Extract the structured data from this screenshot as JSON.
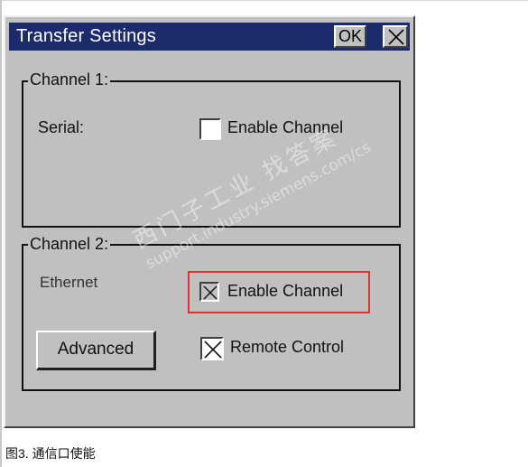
{
  "dialog": {
    "title": "Transfer Settings",
    "ok_label": "OK",
    "close_icon": "close-icon"
  },
  "channel1": {
    "group_label": "Channel 1:",
    "interface_label": "Serial:",
    "enable_label": "Enable Channel",
    "enable_checked": false
  },
  "channel2": {
    "group_label": "Channel 2:",
    "interface_label": "Ethernet",
    "enable_label": "Enable Channel",
    "enable_checked": true,
    "advanced_label": "Advanced",
    "remote_label": "Remote Control",
    "remote_checked": true
  },
  "highlight_color": "#e03030",
  "watermark": {
    "line1": "西门子工业  找答案",
    "line2": "support.industry.siemens.com/cs"
  },
  "caption": "图3. 通信口使能"
}
